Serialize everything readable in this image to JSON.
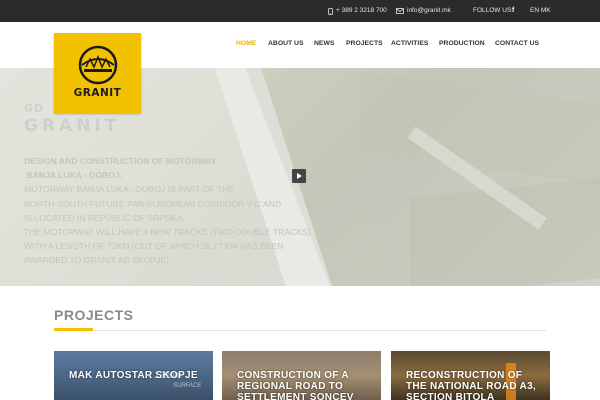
{
  "topbar": {
    "phone": "+ 389 2 3218 700",
    "email": "info@granit.mk",
    "follow_label": "FOLLOW US:",
    "social_icon": "facebook-icon",
    "social_glyph": "f",
    "language": "EN MK"
  },
  "logo": {
    "text": "GRANIT"
  },
  "nav": {
    "items": [
      {
        "label": "HOME",
        "active": true
      },
      {
        "label": "ABOUT US",
        "active": false
      },
      {
        "label": "NEWS",
        "active": false
      },
      {
        "label": "PROJECTS",
        "active": false
      },
      {
        "label": "ACTIVITIES",
        "active": false
      },
      {
        "label": "PRODUCTION",
        "active": false
      },
      {
        "label": "CONTACT US",
        "active": false
      }
    ]
  },
  "hero": {
    "title_small": "GD",
    "title_big": "GRANIT",
    "lines": [
      "DESIGN AND CONSTRUCTION OF MOTORWAY",
      " BANJA LUKA - DOBOJ.",
      "MOTORWAY BANJA LUKA - DOBOJ IS PART OF THE",
      "NORTH-SOUTH FUTURE PAN-EUROPEAN CORRIDOR V-C AND",
      "IS LOCATED IN REPUBLIC OF SRPSKA.",
      "THE MOTORWAY WILL HAVE 4 NEW TRACKS (TWO DOUBLE TRACKS)",
      "WITH A LENGTH OF 72km (OUT OF WHICH 28,77 km HAS BEEN",
      "AWARDED TO GRANIT AD SKOPJE)."
    ],
    "play_icon": "play-icon"
  },
  "projects": {
    "heading": "PROJECTS",
    "cards": [
      {
        "caption": "MAK AUTOSTAR SKOPJE",
        "watermark": "1280m",
        "watermark2": "SURFACE"
      },
      {
        "caption": "CONSTRUCTION OF A REGIONAL ROAD TO SETTLEMENT SONCEV GRAD"
      },
      {
        "caption": "RECONSTRUCTION OF THE NATIONAL ROAD A3, SECTION BITOLA"
      }
    ]
  },
  "colors": {
    "accent": "#f2c200",
    "topbar_bg": "#2b2b2b",
    "nav_active": "#e8b400"
  }
}
